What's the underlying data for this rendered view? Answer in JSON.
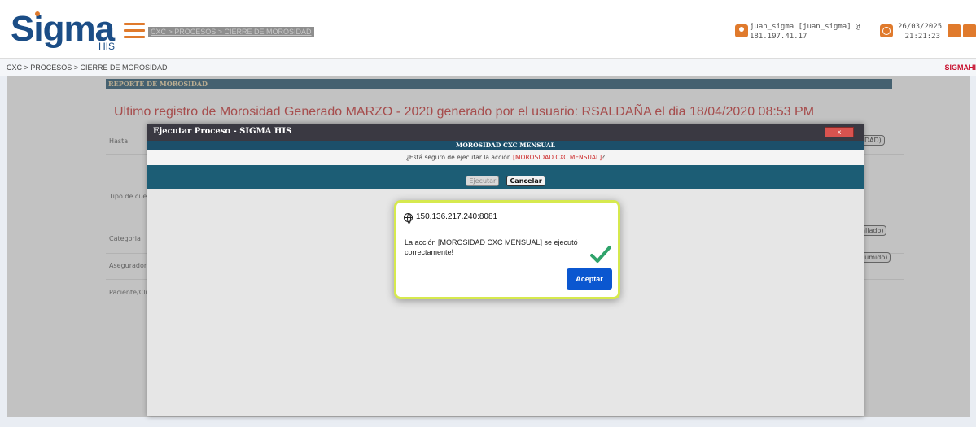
{
  "header": {
    "logo_text": "Sigma",
    "logo_sub": "HIS",
    "breadcrumb": "CXC > PROCESOS > CIERRE DE MOROSIDAD",
    "user_line1": "juan_sigma [juan_sigma] @",
    "user_line2": "181.197.41.17",
    "date": "26/03/2025",
    "time": "21:21:23"
  },
  "crumb_bar": {
    "path": "CXC > PROCESOS > CIERRE DE MOROSIDAD",
    "app_name": "SIGMAHI"
  },
  "report": {
    "section_title": "REPORTE DE MOROSIDAD",
    "last_record": "Ultimo registro de Morosidad Generado MARZO - 2020 generado por el usuario: RSALDAÑA el dia 18/04/2020 08:53 PM",
    "labels": {
      "hasta": "Hasta",
      "tipo_cuenta": "Tipo de cue",
      "categoria": "Categoria",
      "asegurador": "Asegurador",
      "paciente": "Paciente/Cli"
    },
    "buttons": {
      "generar": "DAD)",
      "detallado": "tallado)",
      "resumido": "sumido)"
    }
  },
  "process_dialog": {
    "title": "Ejecutar Proceso - SIGMA HIS",
    "close_label": "x",
    "subtitle": "MOROSIDAD CXC MENSUAL",
    "question_prefix": "¿Está seguro de ejecutar la acción ",
    "question_action": "[MOROSIDAD CXC MENSUAL]",
    "question_suffix": "?",
    "ejecutar_label": "Ejecutar",
    "cancelar_label": "Cancelar"
  },
  "alert": {
    "host": "150.136.217.240:8081",
    "message": "La acción [MOROSIDAD CXC MENSUAL] se ejecutó correctamente!",
    "ok_label": "Aceptar"
  },
  "colors": {
    "brand_blue": "#1b4d86",
    "brand_orange": "#e07a2c",
    "section_bar": "#1c4f6a",
    "alert_highlight": "#d6e94e",
    "ok_button": "#0b57d0",
    "check_green": "#2fa36b"
  }
}
